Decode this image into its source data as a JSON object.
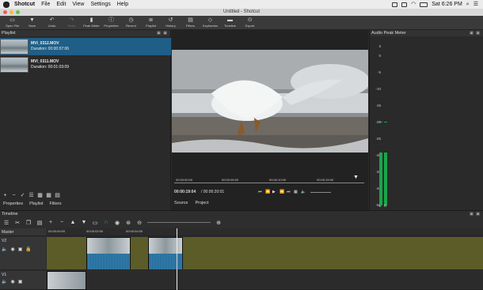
{
  "menubar": {
    "app": "Shotcut",
    "items": [
      "File",
      "Edit",
      "View",
      "Settings",
      "Help"
    ],
    "clock": "Sat 6:26 PM"
  },
  "window": {
    "title": "Untitled - Shotcut"
  },
  "toolbar": [
    {
      "label": "Open File",
      "icon": "folder-icon",
      "enabled": true
    },
    {
      "label": "Save",
      "icon": "save-icon",
      "enabled": true
    },
    {
      "label": "Undo",
      "icon": "undo-icon",
      "enabled": true
    },
    {
      "label": "Redo",
      "icon": "redo-icon",
      "enabled": false
    },
    {
      "label": "Peak Meter",
      "icon": "peak-meter-icon",
      "enabled": true
    },
    {
      "label": "Properties",
      "icon": "properties-icon",
      "enabled": true
    },
    {
      "label": "Recent",
      "icon": "recent-icon",
      "enabled": true
    },
    {
      "label": "Playlist",
      "icon": "playlist-icon",
      "enabled": true
    },
    {
      "label": "History",
      "icon": "history-icon",
      "enabled": true
    },
    {
      "label": "Filters",
      "icon": "filters-icon",
      "enabled": true
    },
    {
      "label": "Keyframes",
      "icon": "keyframes-icon",
      "enabled": true
    },
    {
      "label": "Timeline",
      "icon": "timeline-icon",
      "enabled": true
    },
    {
      "label": "Export",
      "icon": "export-icon",
      "enabled": true
    }
  ],
  "playlist": {
    "title": "Playlist",
    "clips": [
      {
        "name": "MVI_0312.MOV",
        "duration": "Duration: 00:00:07:06",
        "selected": true
      },
      {
        "name": "MVI_0311.MOV",
        "duration": "Duration: 00:01:03:09",
        "selected": false
      }
    ],
    "tabs": [
      "Properties",
      "Playlist",
      "Filters"
    ]
  },
  "viewer": {
    "ruler": [
      "00:00:00:00",
      "00:00:05:00",
      "00:00:10:00",
      "00:00:15:00"
    ],
    "current_time": "00:00:19:04",
    "total_time": "/ 00:00:20:01",
    "tabs": [
      "Source",
      "Project"
    ]
  },
  "meter": {
    "title": "Audio Peak Meter",
    "scale": [
      "3",
      "0",
      "-5",
      "-10",
      "-15",
      "-20",
      "-25",
      "-30",
      "-35",
      "-40",
      "-50"
    ],
    "channels": [
      "L",
      "R"
    ],
    "levels": [
      0.55,
      0.55
    ],
    "color": "#1aa64a"
  },
  "timeline": {
    "title": "Timeline",
    "ruler": [
      "00:00:00:00",
      "00:00:02:00",
      "00:00:04:00"
    ],
    "tracks": [
      {
        "name": "Master"
      },
      {
        "name": "V2"
      },
      {
        "name": "V1"
      }
    ]
  },
  "colors": {
    "accent": "#1f5e86",
    "track_fill": "#6e6f2d"
  }
}
